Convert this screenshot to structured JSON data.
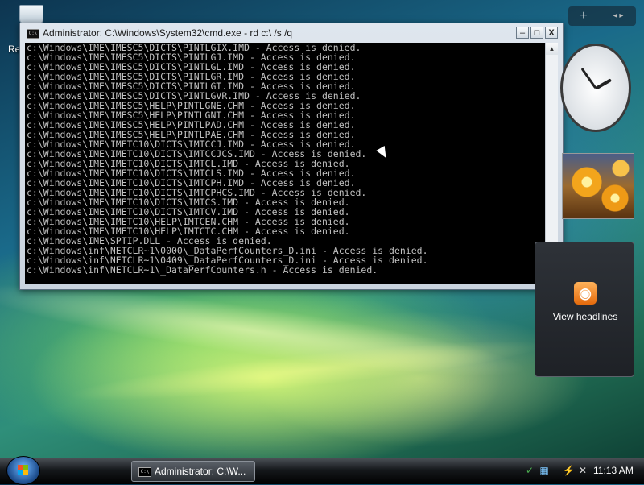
{
  "desktop": {
    "recycle_bin_label": "Re"
  },
  "window": {
    "title": "Administrator: C:\\Windows\\System32\\cmd.exe - rd  c:\\ /s /q",
    "icon_text": "C:\\",
    "controls": {
      "minimize": "–",
      "maximize": "□",
      "close": "X"
    },
    "console_lines": [
      "c:\\Windows\\IME\\IMESC5\\DICTS\\PINTLGIX.IMD - Access is denied.",
      "c:\\Windows\\IME\\IMESC5\\DICTS\\PINTLGJ.IMD - Access is denied.",
      "c:\\Windows\\IME\\IMESC5\\DICTS\\PINTLGL.IMD - Access is denied.",
      "c:\\Windows\\IME\\IMESC5\\DICTS\\PINTLGR.IMD - Access is denied.",
      "c:\\Windows\\IME\\IMESC5\\DICTS\\PINTLGT.IMD - Access is denied.",
      "c:\\Windows\\IME\\IMESC5\\DICTS\\PINTLGVR.IMD - Access is denied.",
      "c:\\Windows\\IME\\IMESC5\\HELP\\PINTLGNE.CHM - Access is denied.",
      "c:\\Windows\\IME\\IMESC5\\HELP\\PINTLGNT.CHM - Access is denied.",
      "c:\\Windows\\IME\\IMESC5\\HELP\\PINTLPAD.CHM - Access is denied.",
      "c:\\Windows\\IME\\IMESC5\\HELP\\PINTLPAE.CHM - Access is denied.",
      "c:\\Windows\\IME\\IMETC10\\DICTS\\IMTCCJ.IMD - Access is denied.",
      "c:\\Windows\\IME\\IMETC10\\DICTS\\IMTCCJCS.IMD - Access is denied.",
      "c:\\Windows\\IME\\IMETC10\\DICTS\\IMTCL.IMD - Access is denied.",
      "c:\\Windows\\IME\\IMETC10\\DICTS\\IMTCLS.IMD - Access is denied.",
      "c:\\Windows\\IME\\IMETC10\\DICTS\\IMTCPH.IMD - Access is denied.",
      "c:\\Windows\\IME\\IMETC10\\DICTS\\IMTCPHCS.IMD - Access is denied.",
      "c:\\Windows\\IME\\IMETC10\\DICTS\\IMTCS.IMD - Access is denied.",
      "c:\\Windows\\IME\\IMETC10\\DICTS\\IMTCV.IMD - Access is denied.",
      "c:\\Windows\\IME\\IMETC10\\HELP\\IMTCEN.CHM - Access is denied.",
      "c:\\Windows\\IME\\IMETC10\\HELP\\IMTCTC.CHM - Access is denied.",
      "c:\\Windows\\IME\\SPTIP.DLL - Access is denied.",
      "c:\\Windows\\inf\\NETCLR~1\\0000\\_DataPerfCounters_D.ini - Access is denied.",
      "c:\\Windows\\inf\\NETCLR~1\\0409\\_DataPerfCounters_D.ini - Access is denied.",
      "c:\\Windows\\inf\\NETCLR~1\\_DataPerfCounters.h - Access is denied."
    ]
  },
  "sidebar": {
    "add_gadget": "+",
    "nav_arrows": "◂ ▸",
    "feed_headlines_label": "View headlines",
    "feed_icon": "rss-icon"
  },
  "taskbar": {
    "start_button": "start-orb",
    "task_button_label": "Administrator: C:\\W...",
    "task_button_icon_text": "C:\\",
    "clock": "11:13 AM"
  }
}
